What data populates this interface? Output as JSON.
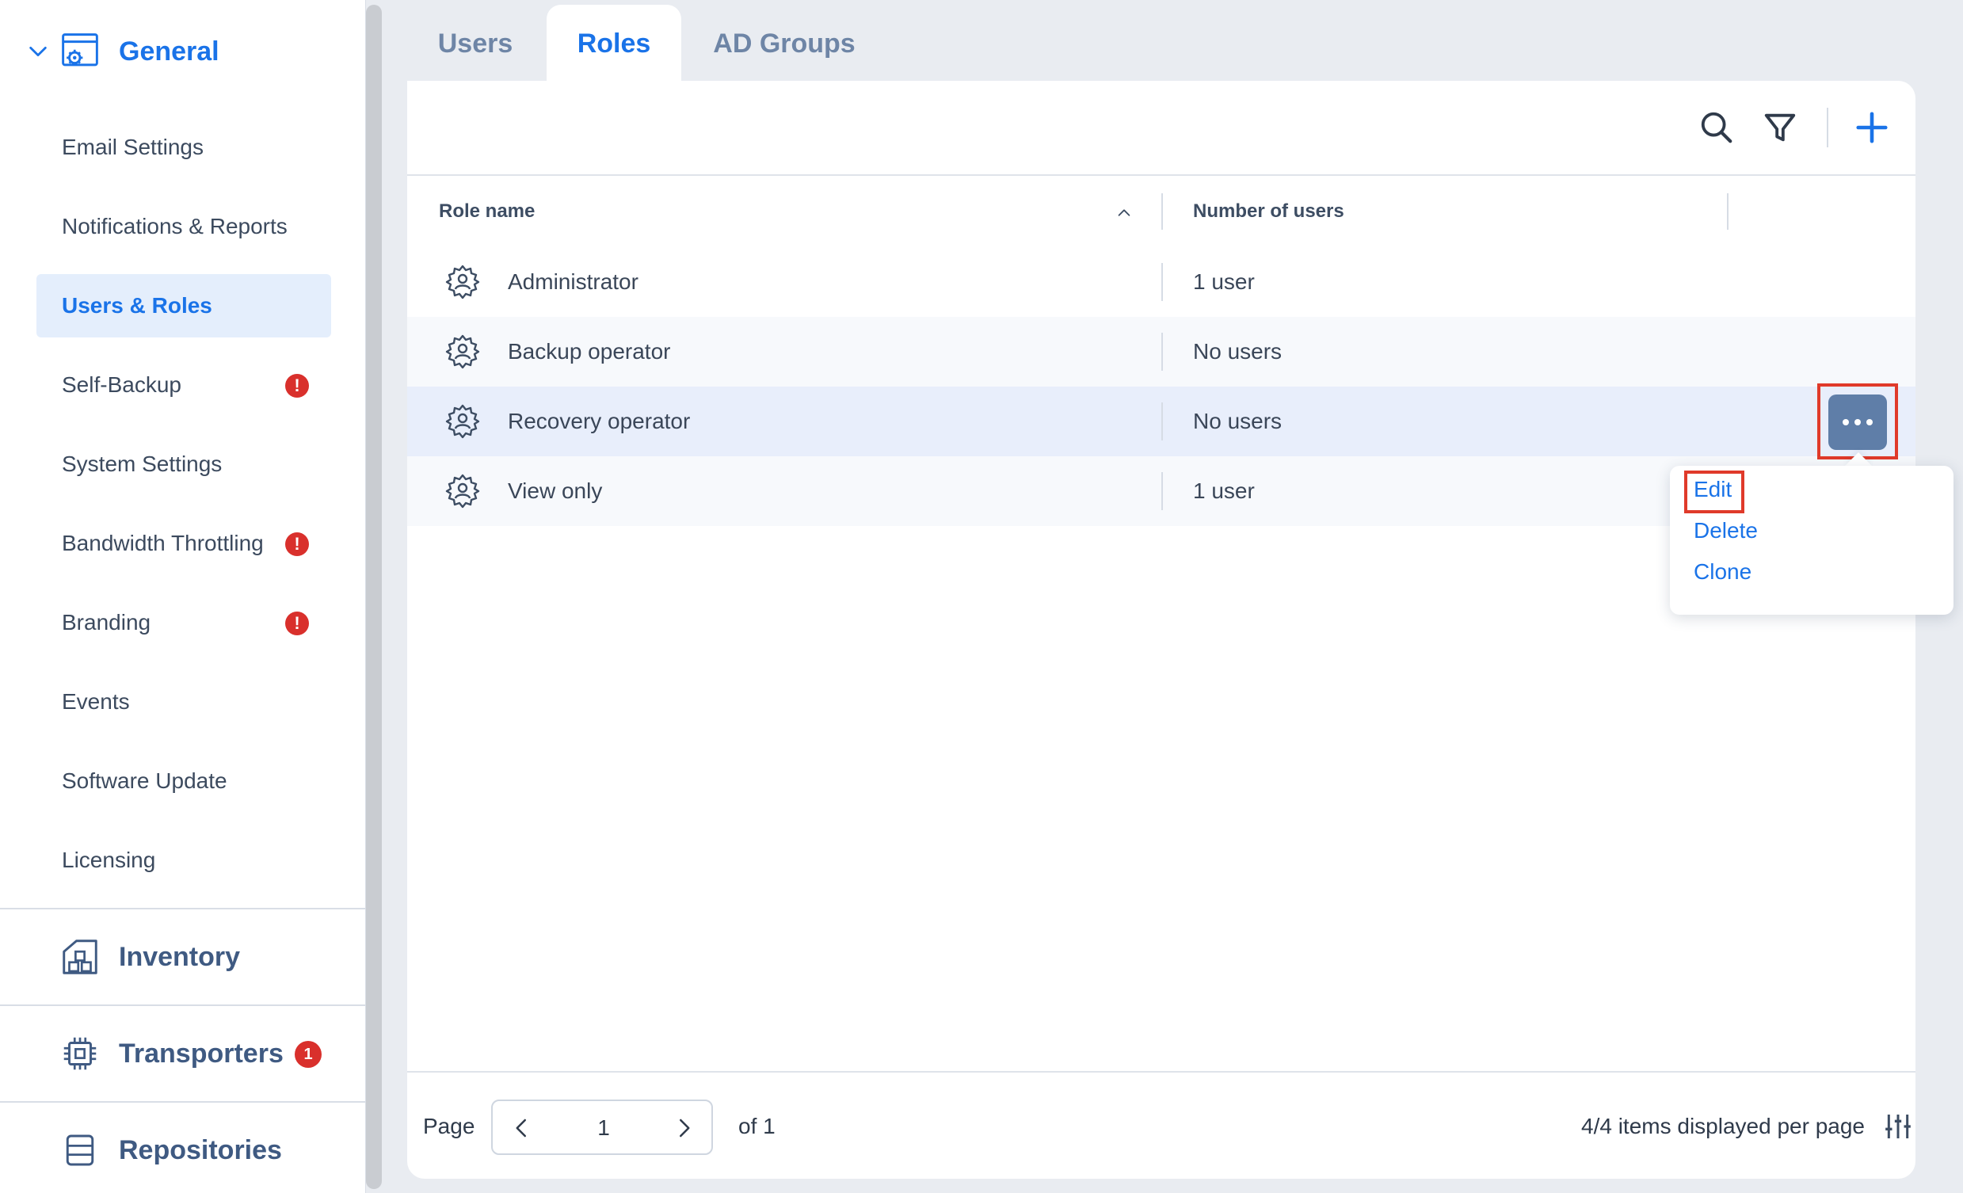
{
  "sidebar": {
    "group": {
      "label": "General",
      "icon": "settings-window-icon"
    },
    "items": [
      {
        "label": "Email Settings",
        "active": false,
        "warning": false
      },
      {
        "label": "Notifications & Reports",
        "active": false,
        "warning": false
      },
      {
        "label": "Users & Roles",
        "active": true,
        "warning": false
      },
      {
        "label": "Self-Backup",
        "active": false,
        "warning": true
      },
      {
        "label": "System Settings",
        "active": false,
        "warning": false
      },
      {
        "label": "Bandwidth Throttling",
        "active": false,
        "warning": true
      },
      {
        "label": "Branding",
        "active": false,
        "warning": true
      },
      {
        "label": "Events",
        "active": false,
        "warning": false
      },
      {
        "label": "Software Update",
        "active": false,
        "warning": false
      },
      {
        "label": "Licensing",
        "active": false,
        "warning": false
      }
    ],
    "warning_glyph": "!",
    "sections": [
      {
        "label": "Inventory",
        "icon": "inventory-icon"
      },
      {
        "label": "Transporters",
        "icon": "transporter-chip-icon",
        "badge": "1"
      },
      {
        "label": "Repositories",
        "icon": "repository-icon"
      }
    ]
  },
  "tabs": [
    {
      "label": "Users",
      "active": false
    },
    {
      "label": "Roles",
      "active": true
    },
    {
      "label": "AD Groups",
      "active": false
    }
  ],
  "toolbar": {
    "icons": [
      "search-icon",
      "filter-icon",
      "add-icon"
    ]
  },
  "table": {
    "columns": [
      "Role name",
      "Number of users"
    ],
    "rows": [
      {
        "name": "Administrator",
        "users": "1 user"
      },
      {
        "name": "Backup operator",
        "users": "No users"
      },
      {
        "name": "Recovery operator",
        "users": "No users"
      },
      {
        "name": "View only",
        "users": "1 user"
      }
    ]
  },
  "context_menu": {
    "items": [
      "Edit",
      "Delete",
      "Clone"
    ]
  },
  "colors": {
    "accent": "#1a73e8",
    "highlight": "#e03a2a",
    "warning": "#d9302c",
    "more_button": "#5f7ea8"
  },
  "pagination": {
    "page_label": "Page",
    "current_page": "1",
    "of_label": "of 1",
    "summary": "4/4 items displayed per page"
  }
}
